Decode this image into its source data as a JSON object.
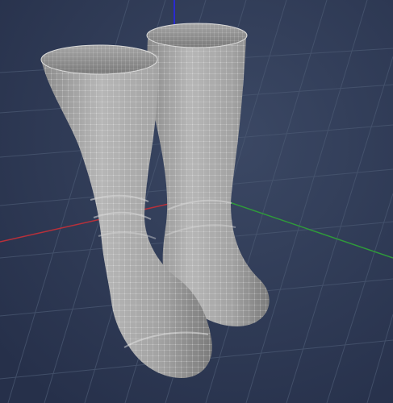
{
  "viewport": {
    "background": "#34405a",
    "grid_color": "#4a5872",
    "axis_colors": {
      "x": "#b8303a",
      "y": "#2f9a3a",
      "z": "#2a2ad0"
    },
    "model": {
      "material": "#a9a9a9",
      "wire": "#f2f2f2",
      "name": "boots-mesh"
    }
  }
}
